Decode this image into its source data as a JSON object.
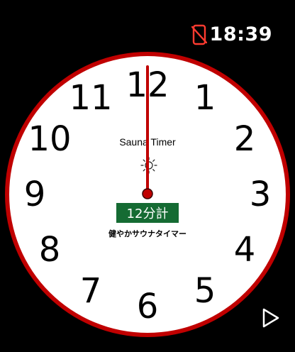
{
  "status_bar": {
    "time": "18:39",
    "phone_icon": "phone-disconnected-icon",
    "phone_icon_color": "#ff3b30"
  },
  "clock": {
    "numerals": [
      "12",
      "1",
      "2",
      "3",
      "4",
      "5",
      "6",
      "7",
      "8",
      "9",
      "10",
      "11"
    ],
    "rim_color": "#c00000",
    "face_color": "#ffffff",
    "hand_color": "#c00000",
    "hand_time": "12:00",
    "app_title": "Sauna Timer",
    "sun_icon": "sun-icon",
    "badge_label": "12分計",
    "badge_color": "#156b33",
    "brand": "健やかサウナタイマー"
  },
  "controls": {
    "play_icon": "play-icon"
  }
}
